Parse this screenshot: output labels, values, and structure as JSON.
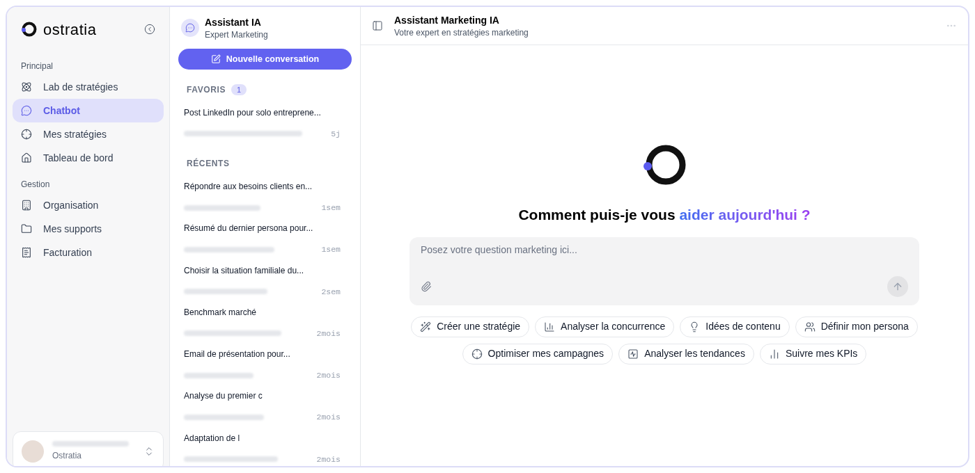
{
  "sidebar": {
    "brand": "ostratia",
    "sections": [
      {
        "title": "Principal",
        "items": [
          {
            "label": "Lab de stratégies",
            "selected": false
          },
          {
            "label": "Chatbot",
            "selected": true
          },
          {
            "label": "Mes stratégies",
            "selected": false
          },
          {
            "label": "Tableau de bord",
            "selected": false
          }
        ]
      },
      {
        "title": "Gestion",
        "items": [
          {
            "label": "Organisation",
            "selected": false
          },
          {
            "label": "Mes supports",
            "selected": false
          },
          {
            "label": "Facturation",
            "selected": false
          }
        ]
      }
    ],
    "user": {
      "org": "Ostratia"
    }
  },
  "conversations": {
    "title": "Assistant IA",
    "subtitle": "Expert Marketing",
    "new_button": "Nouvelle conversation",
    "groups": [
      {
        "title": "FAVORIS",
        "count": "1",
        "items": [
          {
            "title": "Post LinkedIn pour solo entreprene...",
            "time": "5j"
          }
        ]
      },
      {
        "title": "RÉCENTS",
        "items": [
          {
            "title": "Répondre aux besoins clients en...",
            "time": "1sem"
          },
          {
            "title": "Résumé du dernier persona pour...",
            "time": "1sem"
          },
          {
            "title": "Choisir la situation familiale du...",
            "time": "2sem"
          },
          {
            "title": "Benchmark marché",
            "time": "2mois"
          },
          {
            "title": "Email de présentation pour...",
            "time": "2mois"
          },
          {
            "title": "Analyse du premier c",
            "time": "2mois"
          },
          {
            "title": "Adaptation de l",
            "time": "2mois"
          }
        ]
      }
    ]
  },
  "main": {
    "title": "Assistant Marketing IA",
    "subtitle": "Votre expert en stratégies marketing",
    "heading": "Comment puis-je vous ",
    "heading_highlight": "aider aujourd'hui ?",
    "input": {
      "placeholder": "Posez votre question marketing ici..."
    },
    "suggestions": [
      {
        "label": "Créer une stratégie"
      },
      {
        "label": "Analyser la concurrence"
      },
      {
        "label": "Idées de contenu"
      },
      {
        "label": "Définir mon persona"
      },
      {
        "label": "Optimiser mes campagnes"
      },
      {
        "label": "Analyser les tendances"
      },
      {
        "label": "Suivre mes KPIs"
      }
    ]
  }
}
